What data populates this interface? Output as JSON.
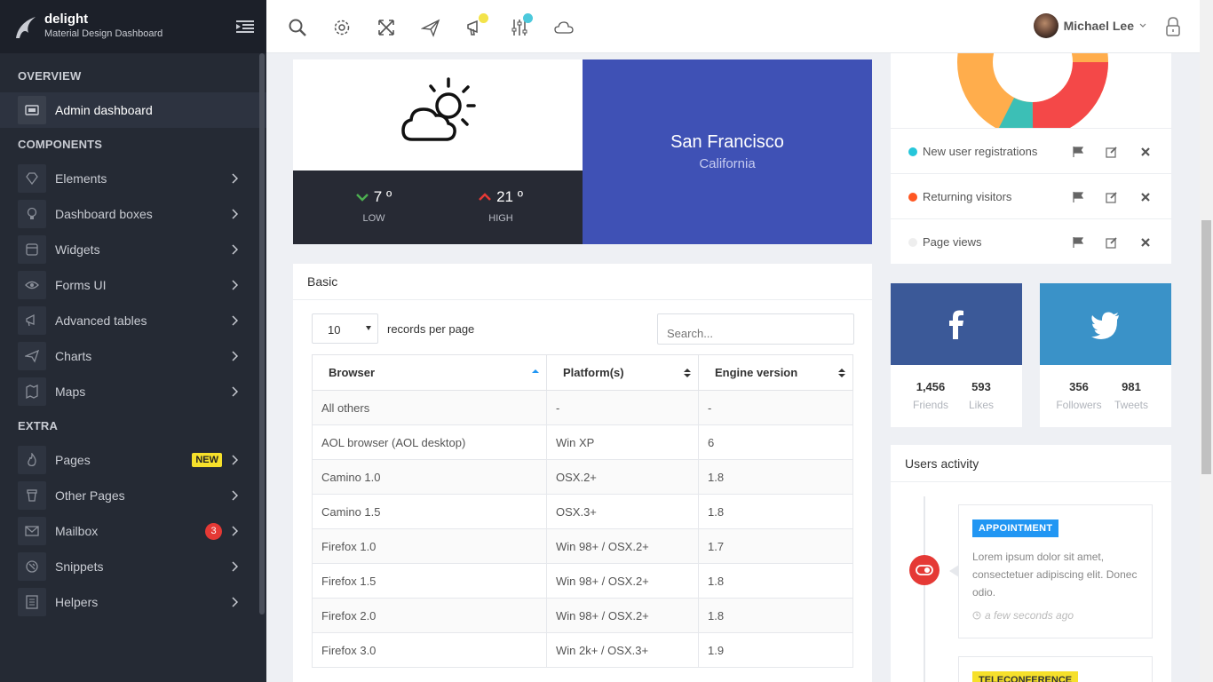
{
  "brand": {
    "name": "delight",
    "subtitle": "Material Design Dashboard"
  },
  "sidebar": {
    "sections": [
      "OVERVIEW",
      "COMPONENTS",
      "EXTRA"
    ],
    "items": [
      {
        "label": "Admin dashboard",
        "icon": "dashboard-icon"
      },
      {
        "label": "Elements",
        "icon": "diamond-icon"
      },
      {
        "label": "Dashboard boxes",
        "icon": "lightbulb-icon"
      },
      {
        "label": "Widgets",
        "icon": "window-icon"
      },
      {
        "label": "Forms UI",
        "icon": "eye-icon"
      },
      {
        "label": "Advanced tables",
        "icon": "megaphone-icon"
      },
      {
        "label": "Charts",
        "icon": "paper-plane-icon"
      },
      {
        "label": "Maps",
        "icon": "map-icon"
      },
      {
        "label": "Pages",
        "icon": "flame-icon",
        "badge": "NEW"
      },
      {
        "label": "Other Pages",
        "icon": "cup-icon"
      },
      {
        "label": "Mailbox",
        "icon": "mail-icon",
        "count": "3"
      },
      {
        "label": "Snippets",
        "icon": "snippet-icon"
      },
      {
        "label": "Helpers",
        "icon": "list-icon"
      }
    ]
  },
  "header": {
    "user_name": "Michael Lee"
  },
  "weather": {
    "city": "San Francisco",
    "state": "California",
    "low": "7 º",
    "low_label": "LOW",
    "high": "21 º",
    "high_label": "HIGH"
  },
  "table": {
    "title": "Basic",
    "page_size": "10",
    "records_label": "records per page",
    "search_placeholder": "Search...",
    "columns": [
      "Browser",
      "Platform(s)",
      "Engine version"
    ],
    "rows": [
      [
        "All others",
        "-",
        "-"
      ],
      [
        "AOL browser (AOL desktop)",
        "Win XP",
        "6"
      ],
      [
        "Camino 1.0",
        "OSX.2+",
        "1.8"
      ],
      [
        "Camino 1.5",
        "OSX.3+",
        "1.8"
      ],
      [
        "Firefox 1.0",
        "Win 98+ / OSX.2+",
        "1.7"
      ],
      [
        "Firefox 1.5",
        "Win 98+ / OSX.2+",
        "1.8"
      ],
      [
        "Firefox 2.0",
        "Win 98+ / OSX.2+",
        "1.8"
      ],
      [
        "Firefox 3.0",
        "Win 2k+ / OSX.3+",
        "1.9"
      ]
    ]
  },
  "legend": [
    {
      "label": "New user registrations",
      "color": "#26c6da"
    },
    {
      "label": "Returning visitors",
      "color": "#ff5722"
    },
    {
      "label": "Page views",
      "color": "#eeeeee"
    }
  ],
  "social": {
    "facebook": {
      "stat1": "1,456",
      "label1": "Friends",
      "stat2": "593",
      "label2": "Likes",
      "color": "#3b5998"
    },
    "twitter": {
      "stat1": "356",
      "label1": "Followers",
      "stat2": "981",
      "label2": "Tweets",
      "color": "#3a92c8"
    }
  },
  "activity": {
    "title": "Users activity",
    "item1": {
      "tag": "APPOINTMENT",
      "text": "Lorem ipsum dolor sit amet, consectetuer adipiscing elit. Donec odio.",
      "time": "a few seconds ago"
    },
    "item2": {
      "tag": "TELECONFERENCE"
    }
  }
}
